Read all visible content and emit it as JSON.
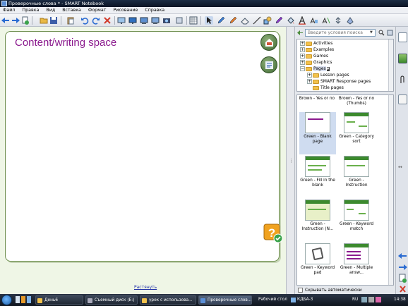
{
  "window": {
    "title": "Проверочные слова * - SMART Notebook"
  },
  "menu": [
    "Файл",
    "Правка",
    "Вид",
    "Вставка",
    "Формат",
    "Рисование",
    "Справка"
  ],
  "toolbar_icons": [
    "back-arrow-icon",
    "forward-arrow-icon",
    "add-page-icon",
    "open-folder-icon",
    "save-icon",
    "paste-icon",
    "undo-icon",
    "redo-icon",
    "delete-icon",
    "screen-shade-icon",
    "full-screen-icon",
    "display-icon",
    "monitor-icon",
    "capture-icon",
    "table-icon",
    "select-arrow-icon",
    "pen-icon",
    "creative-pen-icon",
    "eraser-icon",
    "line-icon",
    "shapes-icon",
    "magic-pen-icon",
    "fill-icon",
    "text-icon",
    "font-icon",
    "properties-icon",
    "more-icon",
    "addon-icon"
  ],
  "canvas": {
    "page_title": "Content/writing space",
    "expand_link": "Растянуть"
  },
  "gallery": {
    "search_placeholder": "Введите условия поиска",
    "tree": [
      {
        "label": "Activities",
        "level": 1,
        "expander": "+"
      },
      {
        "label": "Examples",
        "level": 1,
        "expander": "+"
      },
      {
        "label": "Games",
        "level": 1,
        "expander": "+"
      },
      {
        "label": "Graphics",
        "level": 1,
        "expander": "+"
      },
      {
        "label": "Pages",
        "level": 1,
        "expander": "−"
      },
      {
        "label": "Lesson pages",
        "level": 2,
        "expander": "+"
      },
      {
        "label": "SMART Response pages",
        "level": 2,
        "expander": "+"
      },
      {
        "label": "Title pages",
        "level": 2,
        "expander": ""
      }
    ],
    "headers": [
      "Brown - Yes or no",
      "Brown - Yes or no (Thumbs)"
    ],
    "items": [
      {
        "label": "Green - Blank page",
        "selected": true
      },
      {
        "label": "Green - Category sort",
        "selected": false
      },
      {
        "label": "Green - Fill in the blank",
        "selected": false
      },
      {
        "label": "Green - Instruction",
        "selected": false
      },
      {
        "label": "Green - Instruction (N...",
        "selected": false
      },
      {
        "label": "Green - Keyword match",
        "selected": false
      },
      {
        "label": "Green - Keyword pad",
        "selected": false
      },
      {
        "label": "Green - Multiple answ...",
        "selected": false
      }
    ],
    "autohide_label": "Скрывать автоматически"
  },
  "side_tabs": [
    "page-sorter-icon",
    "gallery-icon",
    "attachments-icon",
    "properties-tab-icon"
  ],
  "taskbar": {
    "items": [
      {
        "label": "День6",
        "active": false
      },
      {
        "label": "Съемный диск (E:)",
        "active": false
      },
      {
        "label": "урок с использова...",
        "active": false
      },
      {
        "label": "Проверочные слов...",
        "active": true
      },
      {
        "label": "Рабочий стол",
        "active": false
      },
      {
        "label": "КДБА-3",
        "active": false
      }
    ],
    "lang": "RU",
    "time": "14:38"
  },
  "colors": {
    "title_purple": "#8b1a8e",
    "canvas_bg": "#eff6e6",
    "accent_green": "#3c8a2e"
  }
}
